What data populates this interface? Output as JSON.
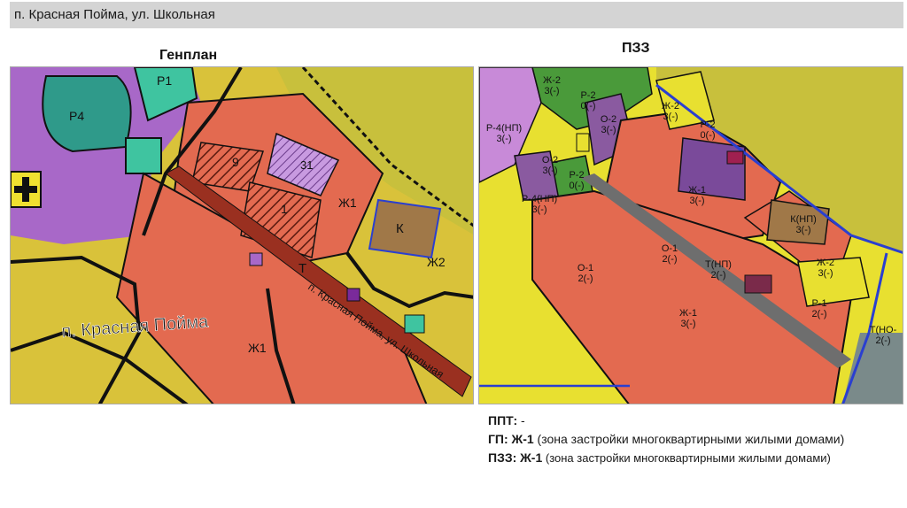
{
  "header": {
    "title": "п. Красная Пойма, ул. Школьная"
  },
  "genplan": {
    "label": "Генплан",
    "labels": {
      "p1": "Р1",
      "p4": "Р4",
      "z1_top": "Ж1",
      "z1_bottom": "Ж1",
      "z2": "Ж2",
      "k": "К",
      "t": "Т",
      "n9": "9",
      "n31": "31",
      "n1": "1",
      "settlement": "п. Красная Пойма",
      "street": "п. Красная Пойма, ул. Школьная"
    }
  },
  "pzz": {
    "label": "ПЗЗ",
    "zones": [
      {
        "code": "Ж-2",
        "sub": "3(-)"
      },
      {
        "code": "Р-2",
        "sub": "0(-)"
      },
      {
        "code": "О-2",
        "sub": "3(-)"
      },
      {
        "code": "Ж-2",
        "sub": "3(-)"
      },
      {
        "code": "Р-2",
        "sub": "0(-)"
      },
      {
        "code": "Р-4(НП)",
        "sub": "3(-)"
      },
      {
        "code": "О-2",
        "sub": "3(-)"
      },
      {
        "code": "Р-2",
        "sub": "0(-)"
      },
      {
        "code": "Ж-1",
        "sub": "3(-)"
      },
      {
        "code": "Р-4(НП)",
        "sub": "3(-)"
      },
      {
        "code": "К(НП)",
        "sub": "3(-)"
      },
      {
        "code": "О-1",
        "sub": "2(-)"
      },
      {
        "code": "Т(НП)",
        "sub": "2(-)"
      },
      {
        "code": "О-1",
        "sub": "2(-)"
      },
      {
        "code": "Ж-2",
        "sub": "3(-)"
      },
      {
        "code": "Р-1",
        "sub": "2(-)"
      },
      {
        "code": "Ж-1",
        "sub": "3(-)"
      },
      {
        "code": "Т(НО-",
        "sub": "2(-)"
      }
    ]
  },
  "info": {
    "ppt_key": "ППТ:",
    "ppt_val": " -",
    "gp_key": "ГП:",
    "gp_code": " Ж-1",
    "gp_desc": " (зона застройки многоквартирными жилыми домами)",
    "pzz_key": "ПЗЗ:",
    "pzz_code": " Ж-1",
    "pzz_desc": " (зона застройки многоквартирными жилыми домами)"
  },
  "colors": {
    "residential_yellow": "#d9c23a",
    "multi_red": "#e36a50",
    "purple": "#a868c8",
    "teal": "#3fb49a",
    "olive": "#c8c03c",
    "brown": "#a07848",
    "green": "#4a9a3a",
    "road_dark": "#8a2a20",
    "grey": "#6e6e6e",
    "zone_border": "#2a3fd0"
  }
}
